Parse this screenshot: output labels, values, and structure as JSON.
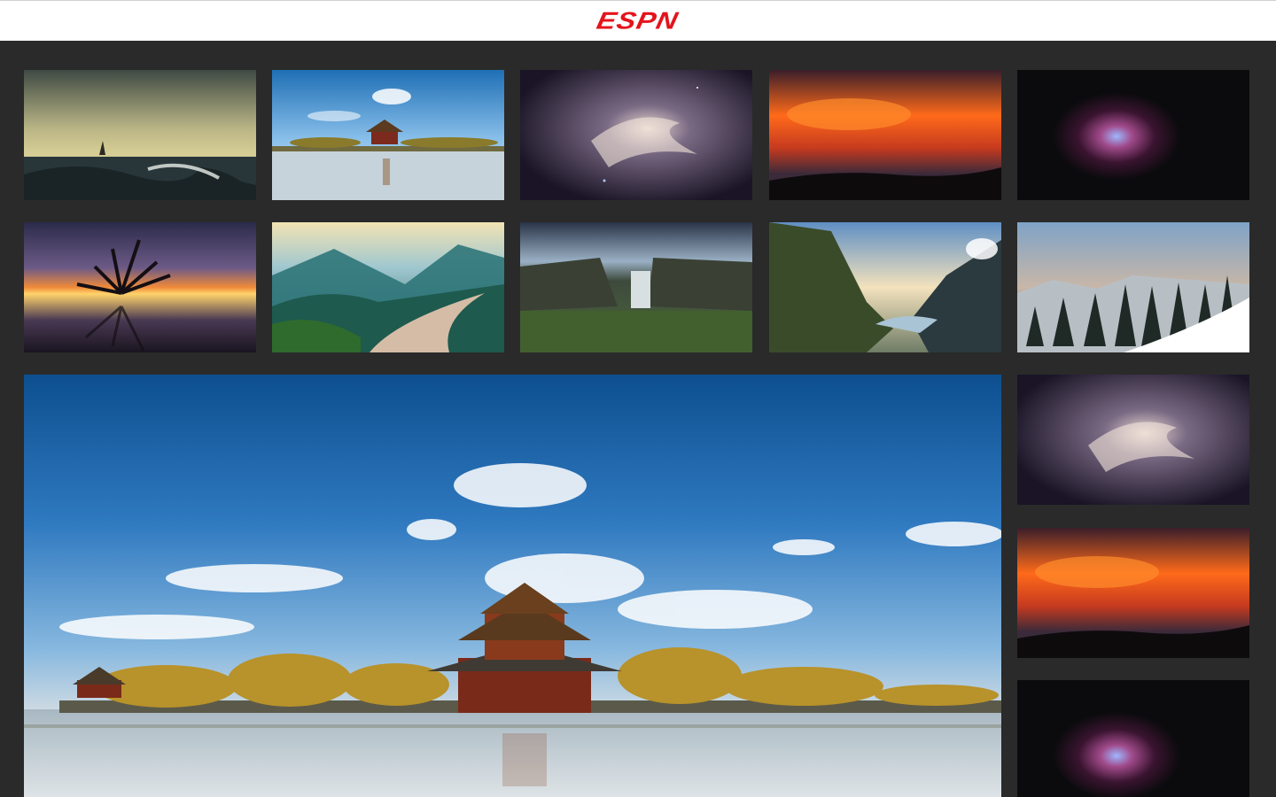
{
  "header": {
    "logo_text": "ESPN",
    "logo_color": "#e4141b"
  },
  "gallery": {
    "thumbnails": [
      {
        "subject": "sailboat-ocean-waves"
      },
      {
        "subject": "forbidden-city-corner-tower"
      },
      {
        "subject": "purple-nebula-clouds"
      },
      {
        "subject": "red-sunset-sky"
      },
      {
        "subject": "pink-space-nebula"
      },
      {
        "subject": "tree-silhouette-sunset"
      },
      {
        "subject": "misty-river-valley"
      },
      {
        "subject": "waterfall-cliffs"
      },
      {
        "subject": "fjord-mountains-sunrays"
      },
      {
        "subject": "snowy-pine-forest"
      },
      {
        "subject": "purple-nebula-clouds"
      },
      {
        "subject": "red-sunset-sky"
      },
      {
        "subject": "pink-space-nebula"
      }
    ],
    "featured": {
      "subject": "forbidden-city-corner-tower"
    }
  }
}
